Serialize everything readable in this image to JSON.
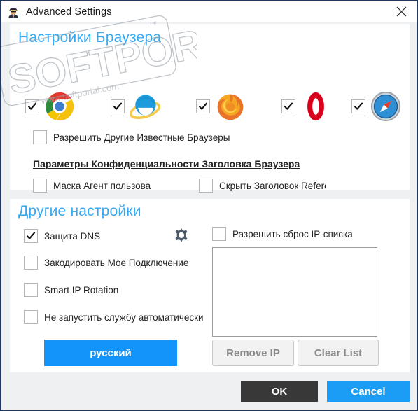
{
  "window": {
    "title": "Advanced Settings",
    "icon": "spy-agent-icon",
    "close_label": "✕",
    "border_color": "#1f3864",
    "background": "#eef0f2"
  },
  "theme": {
    "accent_blue": "#1394fa",
    "section_title_blue": "#36a9f4",
    "ok_dark": "#383838",
    "panel_white": "#ffffff"
  },
  "browser_section": {
    "title": "Настройки Браузера",
    "browsers": [
      {
        "name": "Chrome",
        "icon": "chrome-icon",
        "checked": true
      },
      {
        "name": "Internet Explorer",
        "icon": "ie-icon",
        "checked": true
      },
      {
        "name": "Firefox",
        "icon": "firefox-icon",
        "checked": true
      },
      {
        "name": "Opera",
        "icon": "opera-icon",
        "checked": true
      },
      {
        "name": "Safari",
        "icon": "safari-icon",
        "checked": true
      }
    ],
    "allow_other_browsers": {
      "label": "Разрешить Другие Известные Браузеры",
      "checked": false
    },
    "privacy_header": "Параметры Конфиденциальности Заголовка Браузера",
    "mask_user_agent": {
      "label": "Маска Агент пользова",
      "checked": false
    },
    "hide_referer": {
      "label": "Скрыть Заголовок Referer",
      "checked": false
    }
  },
  "other_section": {
    "title": "Другие настройки",
    "dns_protection": {
      "label": "Защита DNS",
      "checked": true
    },
    "gear_icon": "gear-icon",
    "encrypt_connection": {
      "label": "Закодировать Мое Подключение",
      "checked": false
    },
    "smart_ip_rotation": {
      "label": "Smart IP Rotation",
      "checked": false
    },
    "no_autostart": {
      "label": "Не запустить службу автоматически",
      "checked": false
    },
    "allow_ip_reset": {
      "label": "Разрешить сброс IP-списка",
      "checked": false
    },
    "ip_list_items": []
  },
  "buttons": {
    "language": "русский",
    "remove_ip": "Remove IP",
    "clear_list": "Clear List",
    "ok": "OK",
    "cancel": "Cancel"
  },
  "watermark": {
    "main": "SOFTPORTAL",
    "url": "www.softportal.com",
    "tm": "™"
  }
}
